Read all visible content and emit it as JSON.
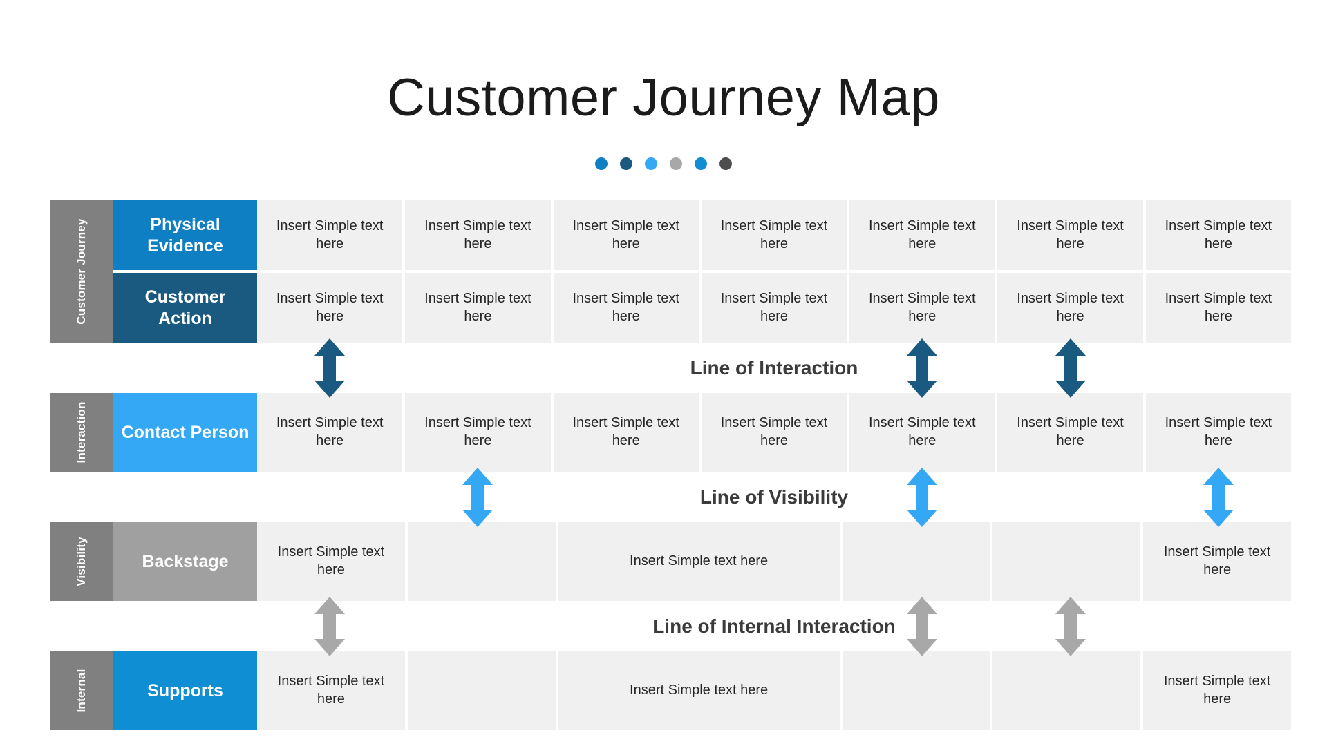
{
  "title": "Customer Journey Map",
  "dots": [
    {
      "name": "dot-1",
      "color": "#0f7fc4"
    },
    {
      "name": "dot-2",
      "color": "#1a5a80"
    },
    {
      "name": "dot-3",
      "color": "#35a8f5"
    },
    {
      "name": "dot-4",
      "color": "#a8a8a8"
    },
    {
      "name": "dot-5",
      "color": "#0f8ed4"
    },
    {
      "name": "dot-6",
      "color": "#4d4d4d"
    }
  ],
  "cell_text": "Insert Simple text here",
  "side_labels": {
    "customer_journey": "Customer Journey",
    "interaction": "Interaction",
    "visibility": "Visibility",
    "internal": "Internal"
  },
  "rows": {
    "physical_evidence": {
      "label": "Physical Evidence",
      "color": "#0f7fc4",
      "cells": [
        "Insert Simple text here",
        "Insert Simple text here",
        "Insert Simple text here",
        "Insert Simple text here",
        "Insert Simple text here",
        "Insert Simple text here",
        "Insert Simple text here"
      ]
    },
    "customer_action": {
      "label": "Customer Action",
      "color": "#1a5a80",
      "cells": [
        "Insert Simple text here",
        "Insert Simple text here",
        "Insert Simple text here",
        "Insert Simple text here",
        "Insert Simple text here",
        "Insert Simple text here",
        "Insert Simple text here"
      ]
    },
    "contact_person": {
      "label": "Contact Person",
      "color": "#35a8f5",
      "cells": [
        "Insert Simple text here",
        "Insert Simple text here",
        "Insert Simple text here",
        "Insert Simple text here",
        "Insert Simple text here",
        "Insert Simple text here",
        "Insert Simple text here"
      ]
    },
    "backstage": {
      "label": "Backstage",
      "color": "#a0a0a0",
      "cells": [
        "Insert Simple text here",
        "",
        "Insert Simple text here",
        "",
        "",
        "Insert Simple text here"
      ]
    },
    "supports": {
      "label": "Supports",
      "color": "#0f8ed4",
      "cells": [
        "Insert Simple text here",
        "",
        "Insert Simple text here",
        "",
        "",
        "Insert Simple text here"
      ]
    }
  },
  "dividers": {
    "interaction": {
      "label": "Line of Interaction",
      "color": "#1a5a80",
      "arrow_columns": [
        1,
        5,
        6
      ]
    },
    "visibility": {
      "label": "Line of Visibility",
      "color": "#35a8f5",
      "arrow_columns": [
        2,
        5,
        7
      ]
    },
    "internal_interaction": {
      "label": "Line of Internal Interaction",
      "color": "#a8a8a8",
      "arrow_columns": [
        1,
        5,
        6
      ]
    }
  }
}
